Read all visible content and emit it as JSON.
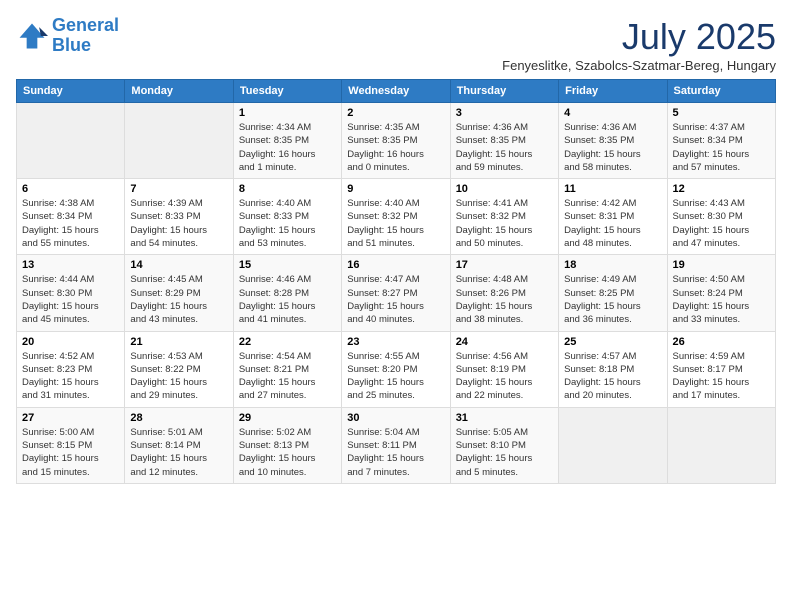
{
  "header": {
    "logo_line1": "General",
    "logo_line2": "Blue",
    "month_title": "July 2025",
    "subtitle": "Fenyeslitke, Szabolcs-Szatmar-Bereg, Hungary"
  },
  "days_of_week": [
    "Sunday",
    "Monday",
    "Tuesday",
    "Wednesday",
    "Thursday",
    "Friday",
    "Saturday"
  ],
  "weeks": [
    [
      {
        "num": "",
        "detail": ""
      },
      {
        "num": "",
        "detail": ""
      },
      {
        "num": "1",
        "detail": "Sunrise: 4:34 AM\nSunset: 8:35 PM\nDaylight: 16 hours\nand 1 minute."
      },
      {
        "num": "2",
        "detail": "Sunrise: 4:35 AM\nSunset: 8:35 PM\nDaylight: 16 hours\nand 0 minutes."
      },
      {
        "num": "3",
        "detail": "Sunrise: 4:36 AM\nSunset: 8:35 PM\nDaylight: 15 hours\nand 59 minutes."
      },
      {
        "num": "4",
        "detail": "Sunrise: 4:36 AM\nSunset: 8:35 PM\nDaylight: 15 hours\nand 58 minutes."
      },
      {
        "num": "5",
        "detail": "Sunrise: 4:37 AM\nSunset: 8:34 PM\nDaylight: 15 hours\nand 57 minutes."
      }
    ],
    [
      {
        "num": "6",
        "detail": "Sunrise: 4:38 AM\nSunset: 8:34 PM\nDaylight: 15 hours\nand 55 minutes."
      },
      {
        "num": "7",
        "detail": "Sunrise: 4:39 AM\nSunset: 8:33 PM\nDaylight: 15 hours\nand 54 minutes."
      },
      {
        "num": "8",
        "detail": "Sunrise: 4:40 AM\nSunset: 8:33 PM\nDaylight: 15 hours\nand 53 minutes."
      },
      {
        "num": "9",
        "detail": "Sunrise: 4:40 AM\nSunset: 8:32 PM\nDaylight: 15 hours\nand 51 minutes."
      },
      {
        "num": "10",
        "detail": "Sunrise: 4:41 AM\nSunset: 8:32 PM\nDaylight: 15 hours\nand 50 minutes."
      },
      {
        "num": "11",
        "detail": "Sunrise: 4:42 AM\nSunset: 8:31 PM\nDaylight: 15 hours\nand 48 minutes."
      },
      {
        "num": "12",
        "detail": "Sunrise: 4:43 AM\nSunset: 8:30 PM\nDaylight: 15 hours\nand 47 minutes."
      }
    ],
    [
      {
        "num": "13",
        "detail": "Sunrise: 4:44 AM\nSunset: 8:30 PM\nDaylight: 15 hours\nand 45 minutes."
      },
      {
        "num": "14",
        "detail": "Sunrise: 4:45 AM\nSunset: 8:29 PM\nDaylight: 15 hours\nand 43 minutes."
      },
      {
        "num": "15",
        "detail": "Sunrise: 4:46 AM\nSunset: 8:28 PM\nDaylight: 15 hours\nand 41 minutes."
      },
      {
        "num": "16",
        "detail": "Sunrise: 4:47 AM\nSunset: 8:27 PM\nDaylight: 15 hours\nand 40 minutes."
      },
      {
        "num": "17",
        "detail": "Sunrise: 4:48 AM\nSunset: 8:26 PM\nDaylight: 15 hours\nand 38 minutes."
      },
      {
        "num": "18",
        "detail": "Sunrise: 4:49 AM\nSunset: 8:25 PM\nDaylight: 15 hours\nand 36 minutes."
      },
      {
        "num": "19",
        "detail": "Sunrise: 4:50 AM\nSunset: 8:24 PM\nDaylight: 15 hours\nand 33 minutes."
      }
    ],
    [
      {
        "num": "20",
        "detail": "Sunrise: 4:52 AM\nSunset: 8:23 PM\nDaylight: 15 hours\nand 31 minutes."
      },
      {
        "num": "21",
        "detail": "Sunrise: 4:53 AM\nSunset: 8:22 PM\nDaylight: 15 hours\nand 29 minutes."
      },
      {
        "num": "22",
        "detail": "Sunrise: 4:54 AM\nSunset: 8:21 PM\nDaylight: 15 hours\nand 27 minutes."
      },
      {
        "num": "23",
        "detail": "Sunrise: 4:55 AM\nSunset: 8:20 PM\nDaylight: 15 hours\nand 25 minutes."
      },
      {
        "num": "24",
        "detail": "Sunrise: 4:56 AM\nSunset: 8:19 PM\nDaylight: 15 hours\nand 22 minutes."
      },
      {
        "num": "25",
        "detail": "Sunrise: 4:57 AM\nSunset: 8:18 PM\nDaylight: 15 hours\nand 20 minutes."
      },
      {
        "num": "26",
        "detail": "Sunrise: 4:59 AM\nSunset: 8:17 PM\nDaylight: 15 hours\nand 17 minutes."
      }
    ],
    [
      {
        "num": "27",
        "detail": "Sunrise: 5:00 AM\nSunset: 8:15 PM\nDaylight: 15 hours\nand 15 minutes."
      },
      {
        "num": "28",
        "detail": "Sunrise: 5:01 AM\nSunset: 8:14 PM\nDaylight: 15 hours\nand 12 minutes."
      },
      {
        "num": "29",
        "detail": "Sunrise: 5:02 AM\nSunset: 8:13 PM\nDaylight: 15 hours\nand 10 minutes."
      },
      {
        "num": "30",
        "detail": "Sunrise: 5:04 AM\nSunset: 8:11 PM\nDaylight: 15 hours\nand 7 minutes."
      },
      {
        "num": "31",
        "detail": "Sunrise: 5:05 AM\nSunset: 8:10 PM\nDaylight: 15 hours\nand 5 minutes."
      },
      {
        "num": "",
        "detail": ""
      },
      {
        "num": "",
        "detail": ""
      }
    ]
  ]
}
